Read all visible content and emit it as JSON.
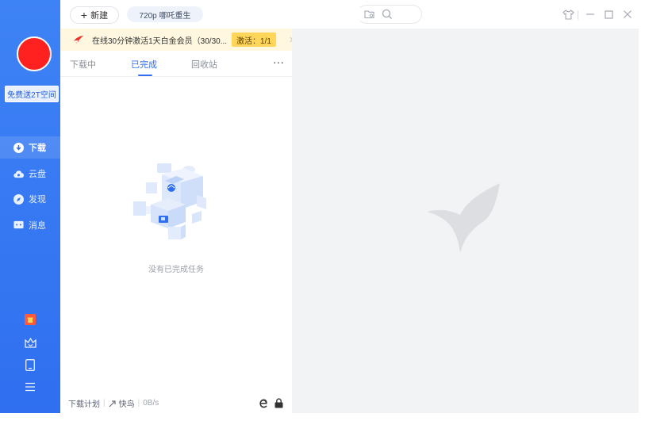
{
  "sidebar": {
    "promo_label": "免费送2T空间",
    "nav": [
      {
        "label": "下载",
        "icon": "download-icon",
        "active": true
      },
      {
        "label": "云盘",
        "icon": "cloud-icon",
        "active": false
      },
      {
        "label": "发现",
        "icon": "compass-icon",
        "active": false
      },
      {
        "label": "消息",
        "icon": "message-icon",
        "active": false
      }
    ],
    "bottom_icons": [
      "gift-icon",
      "crown-icon",
      "tablet-icon",
      "menu-icon"
    ]
  },
  "topbar": {
    "new_label": "新建",
    "tag_label": "720p 哪吒重生",
    "icons": [
      "folder-search-icon",
      "search-icon",
      "skin-icon",
      "minimize-icon",
      "maximize-icon",
      "close-icon"
    ]
  },
  "banner": {
    "text": "在线30分钟激活1天白金会员（30/30...",
    "pill": "激活：1/1"
  },
  "tabs": [
    {
      "label": "下载中",
      "active": false
    },
    {
      "label": "已完成",
      "active": true
    },
    {
      "label": "回收站",
      "active": false
    }
  ],
  "more_label": "···",
  "empty_text": "没有已完成任务",
  "bottom_bar": {
    "plan_label": "下载计划",
    "speed_mode": "快鸟",
    "speed": "0B/s"
  },
  "colors": {
    "sidebar": "#3e83f5",
    "accent": "#2f6ff0",
    "banner_bg": "#fff7e0",
    "pill_bg": "#ffd659",
    "right_bg": "#f2f3f5"
  }
}
